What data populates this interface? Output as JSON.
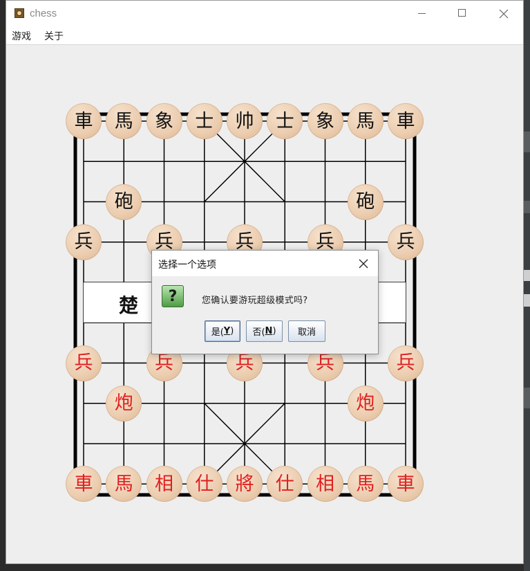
{
  "window": {
    "title": "chess",
    "menu": [
      "游戏",
      "关于"
    ]
  },
  "board": {
    "river_left": "楚",
    "pieces": [
      {
        "label": "車",
        "side": "black",
        "col": 0,
        "row": 0
      },
      {
        "label": "馬",
        "side": "black",
        "col": 1,
        "row": 0
      },
      {
        "label": "象",
        "side": "black",
        "col": 2,
        "row": 0
      },
      {
        "label": "士",
        "side": "black",
        "col": 3,
        "row": 0
      },
      {
        "label": "帅",
        "side": "black",
        "col": 4,
        "row": 0
      },
      {
        "label": "士",
        "side": "black",
        "col": 5,
        "row": 0
      },
      {
        "label": "象",
        "side": "black",
        "col": 6,
        "row": 0
      },
      {
        "label": "馬",
        "side": "black",
        "col": 7,
        "row": 0
      },
      {
        "label": "車",
        "side": "black",
        "col": 8,
        "row": 0
      },
      {
        "label": "砲",
        "side": "black",
        "col": 1,
        "row": 2
      },
      {
        "label": "砲",
        "side": "black",
        "col": 7,
        "row": 2
      },
      {
        "label": "兵",
        "side": "black",
        "col": 0,
        "row": 3
      },
      {
        "label": "兵",
        "side": "black",
        "col": 2,
        "row": 3
      },
      {
        "label": "兵",
        "side": "black",
        "col": 4,
        "row": 3
      },
      {
        "label": "兵",
        "side": "black",
        "col": 6,
        "row": 3
      },
      {
        "label": "兵",
        "side": "black",
        "col": 8,
        "row": 3
      },
      {
        "label": "兵",
        "side": "red",
        "col": 0,
        "row": 6
      },
      {
        "label": "兵",
        "side": "red",
        "col": 2,
        "row": 6
      },
      {
        "label": "兵",
        "side": "red",
        "col": 4,
        "row": 6
      },
      {
        "label": "兵",
        "side": "red",
        "col": 6,
        "row": 6
      },
      {
        "label": "兵",
        "side": "red",
        "col": 8,
        "row": 6
      },
      {
        "label": "炮",
        "side": "red",
        "col": 1,
        "row": 7
      },
      {
        "label": "炮",
        "side": "red",
        "col": 7,
        "row": 7
      },
      {
        "label": "車",
        "side": "red",
        "col": 0,
        "row": 9
      },
      {
        "label": "馬",
        "side": "red",
        "col": 1,
        "row": 9
      },
      {
        "label": "相",
        "side": "red",
        "col": 2,
        "row": 9
      },
      {
        "label": "仕",
        "side": "red",
        "col": 3,
        "row": 9
      },
      {
        "label": "將",
        "side": "red",
        "col": 4,
        "row": 9
      },
      {
        "label": "仕",
        "side": "red",
        "col": 5,
        "row": 9
      },
      {
        "label": "相",
        "side": "red",
        "col": 6,
        "row": 9
      },
      {
        "label": "馬",
        "side": "red",
        "col": 7,
        "row": 9
      },
      {
        "label": "車",
        "side": "red",
        "col": 8,
        "row": 9
      }
    ]
  },
  "dialog": {
    "title": "选择一个选项",
    "message": "您确认要游玩超级模式吗?",
    "buttons": {
      "yes": {
        "text": "是(",
        "mnemonic": "Y",
        "suffix": ")"
      },
      "no": {
        "text": "否(",
        "mnemonic": "N",
        "suffix": ")"
      },
      "cancel": "取消"
    }
  },
  "colors": {
    "red_piece": "#e02020",
    "black_piece": "#111111",
    "piece_wood": "#ecceb1",
    "dialog_icon": "#4f9c45"
  },
  "icons": {
    "app": "chess-app-icon",
    "dialog": "question-icon"
  }
}
